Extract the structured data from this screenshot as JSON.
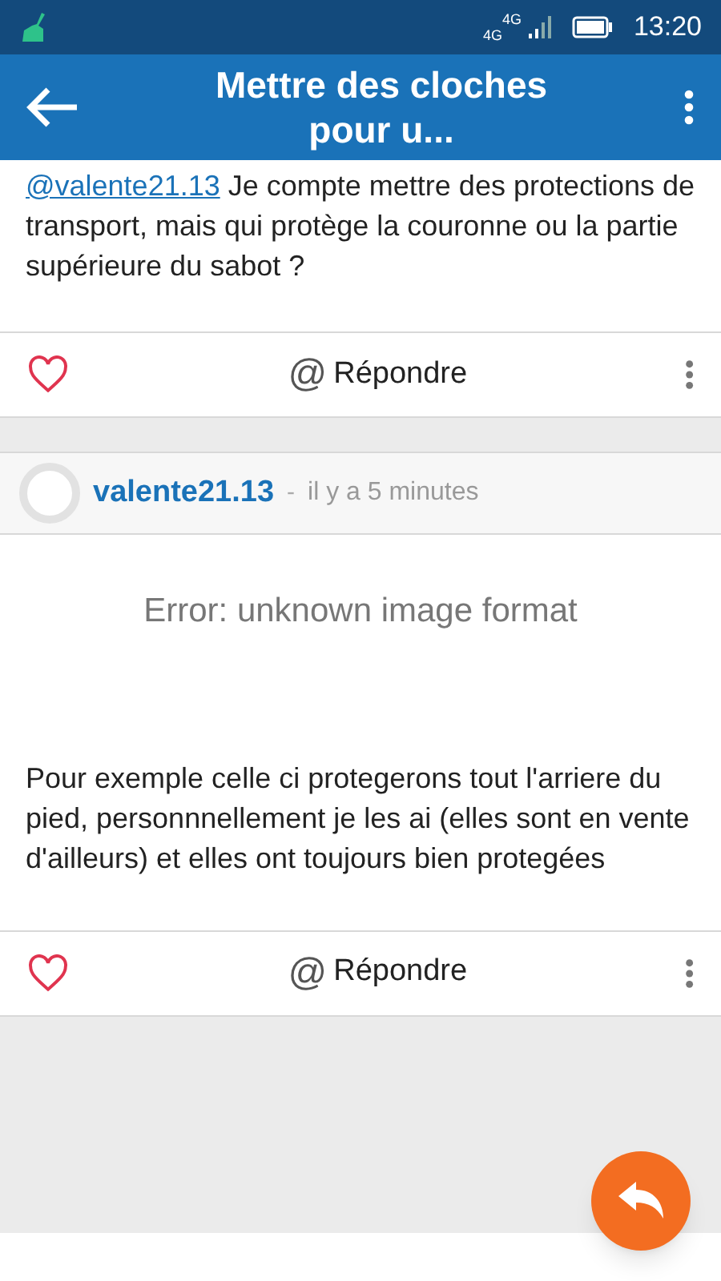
{
  "status_bar": {
    "network_top": "4G",
    "network_bottom": "4G",
    "time": "13:20"
  },
  "app_bar": {
    "title": "Mettre des cloches pour u..."
  },
  "posts": [
    {
      "mention": "@valente21.13",
      "text": "Je compte mettre des protections de transport, mais qui protège la couronne ou la partie supérieure du sabot ?",
      "liked": false,
      "reply_icon": "@",
      "reply_label": "Répondre"
    },
    {
      "author": "valente21.13",
      "separator": "-",
      "time": "il y a 5 minutes",
      "image_error": "Error: unknown image format",
      "text": "Pour exemple celle ci protegerons tout l'arriere du pied, personnnellement je les ai (elles sont en vente d'ailleurs) et elles ont toujours bien protegées",
      "liked": false,
      "reply_icon": "@",
      "reply_label": "Répondre"
    }
  ]
}
